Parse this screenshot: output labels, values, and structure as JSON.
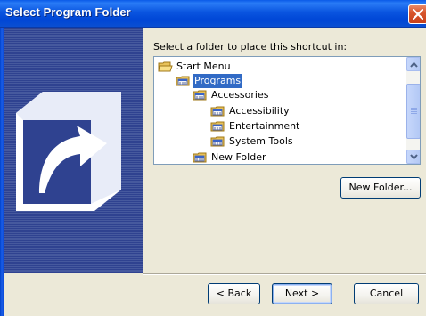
{
  "window": {
    "title": "Select Program Folder"
  },
  "prompt": "Select a folder to place this shortcut in:",
  "tree": {
    "items": [
      {
        "label": "Start Menu",
        "selected": false,
        "icon": "folder-open-icon"
      },
      {
        "label": "Programs",
        "selected": true,
        "icon": "program-folder-icon"
      },
      {
        "label": "Accessories",
        "selected": false,
        "icon": "program-folder-icon"
      },
      {
        "label": "Accessibility",
        "selected": false,
        "icon": "program-folder-icon"
      },
      {
        "label": "Entertainment",
        "selected": false,
        "icon": "program-folder-icon"
      },
      {
        "label": "System Tools",
        "selected": false,
        "icon": "program-folder-icon"
      },
      {
        "label": "New Folder",
        "selected": false,
        "icon": "program-folder-icon"
      }
    ]
  },
  "buttons": {
    "new_folder": "New Folder...",
    "back": "< Back",
    "next": "Next >",
    "cancel": "Cancel"
  },
  "colors": {
    "title_bar": "#0a55e0",
    "selection": "#316ac5",
    "dialog_bg": "#ece9d8",
    "sidebar": "#3a4ea0"
  }
}
